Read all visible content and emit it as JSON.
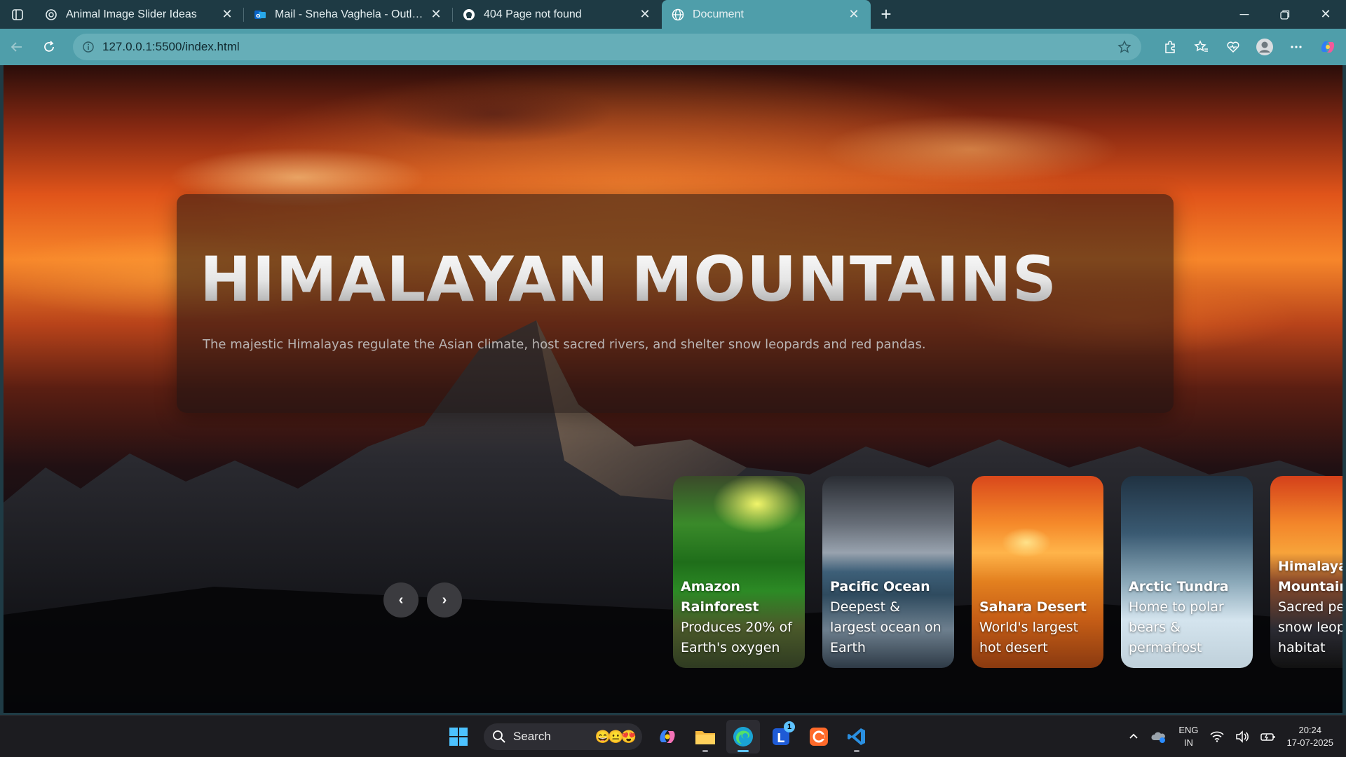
{
  "browser": {
    "tabs": [
      {
        "title": "Animal Image Slider Ideas",
        "icon": "openai-icon",
        "active": false
      },
      {
        "title": "Mail - Sneha Vaghela - Outlook",
        "icon": "outlook-icon",
        "active": false
      },
      {
        "title": "404 Page not found",
        "icon": "github-icon",
        "active": false
      },
      {
        "title": "Document",
        "icon": "globe-icon",
        "active": true
      }
    ],
    "url": "127.0.0.1:5500/index.html"
  },
  "hero": {
    "title": "HIMALAYAN MOUNTAINS",
    "description": "The majestic Himalayas regulate the Asian climate, host sacred rivers, and shelter snow leopards and red pandas."
  },
  "controls": {
    "prev": "‹",
    "next": "›"
  },
  "cards": [
    {
      "name": "Amazon Rainforest",
      "desc": "Produces 20% of Earth's oxygen"
    },
    {
      "name": "Pacific Ocean",
      "desc": "Deepest & largest ocean on Earth"
    },
    {
      "name": "Sahara Desert",
      "desc": "World's largest hot desert"
    },
    {
      "name": "Arctic Tundra",
      "desc": "Home to polar bears & permafrost"
    },
    {
      "name": "Himalaya Mountains",
      "desc": "Sacred pe snow leop habitat"
    }
  ],
  "taskbar": {
    "search_label": "Search",
    "search_emoji": "😄😐😍",
    "lens_badge": "1",
    "lang_top": "ENG",
    "lang_bottom": "IN",
    "time": "20:24",
    "date": "17-07-2025"
  },
  "colors": {
    "tab_strip": "#1e3a44",
    "toolbar": "#4f9eaa",
    "accent": "#5ec3ff"
  }
}
